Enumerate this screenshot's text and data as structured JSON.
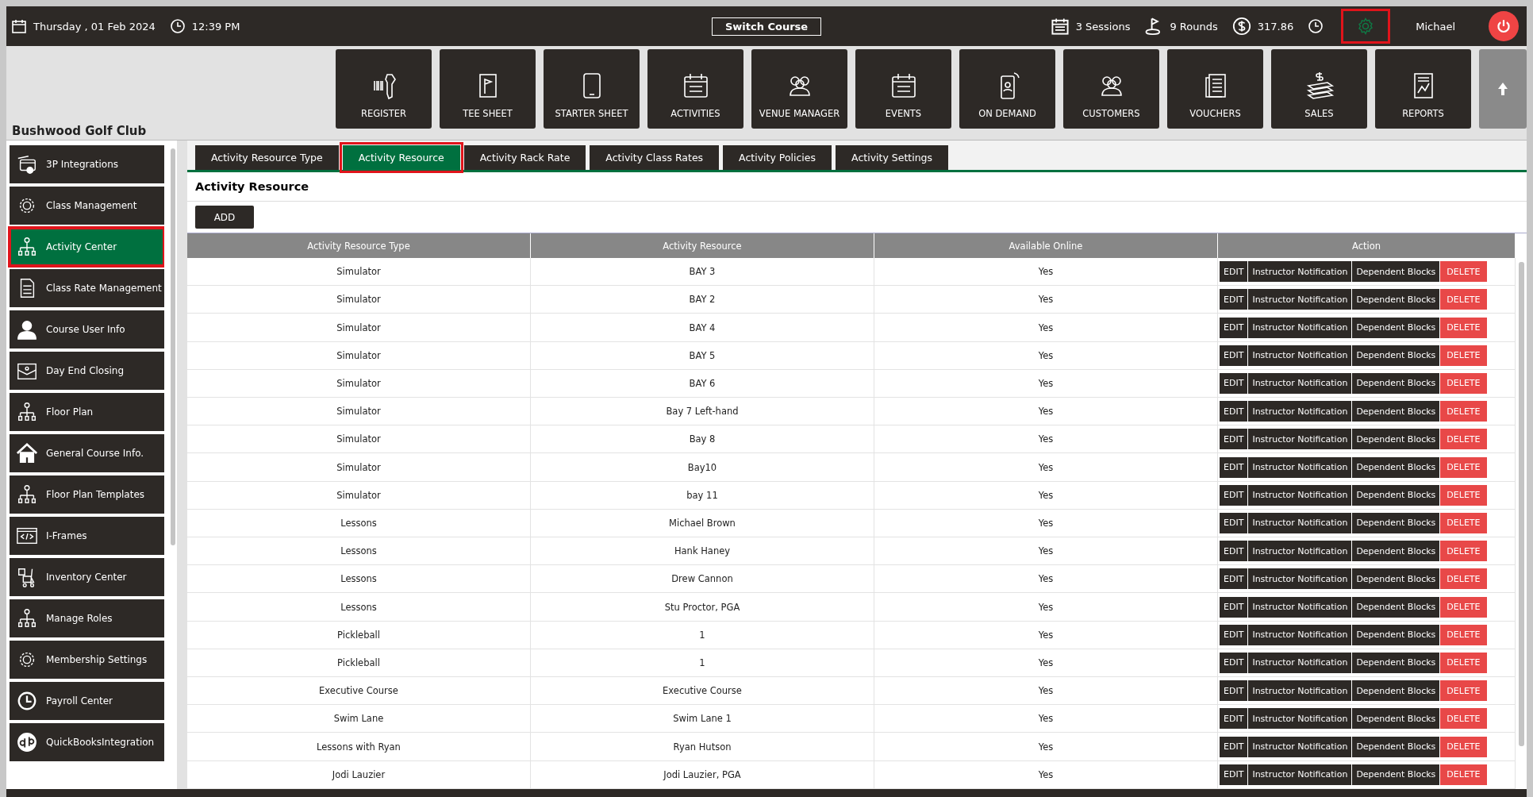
{
  "topbar": {
    "date": "Thursday ,  01 Feb 2024",
    "time": "12:39 PM",
    "switch_course": "Switch Course",
    "sessions": "3 Sessions",
    "rounds": "9 Rounds",
    "balance": "317.86",
    "settings_highlighted": true,
    "user": "Michael"
  },
  "nav_buttons": [
    {
      "label": "REGISTER"
    },
    {
      "label": "TEE SHEET"
    },
    {
      "label": "STARTER SHEET"
    },
    {
      "label": "ACTIVITIES"
    },
    {
      "label": "VENUE MANAGER"
    },
    {
      "label": "EVENTS"
    },
    {
      "label": "ON DEMAND"
    },
    {
      "label": "CUSTOMERS"
    },
    {
      "label": "VOUCHERS"
    },
    {
      "label": "SALES"
    },
    {
      "label": "REPORTS"
    }
  ],
  "club_name": "Bushwood Golf Club",
  "sidebar": {
    "items": [
      {
        "label": "3P Integrations",
        "selected": false
      },
      {
        "label": "Class Management",
        "selected": false
      },
      {
        "label": "Activity  Center",
        "selected": true
      },
      {
        "label": "Class Rate Management",
        "selected": false
      },
      {
        "label": "Course User Info",
        "selected": false
      },
      {
        "label": "Day End Closing",
        "selected": false
      },
      {
        "label": "Floor Plan",
        "selected": false
      },
      {
        "label": "General Course Info.",
        "selected": false
      },
      {
        "label": "Floor Plan Templates",
        "selected": false
      },
      {
        "label": "I-Frames",
        "selected": false
      },
      {
        "label": "Inventory Center",
        "selected": false
      },
      {
        "label": "Manage Roles",
        "selected": false
      },
      {
        "label": "Membership Settings",
        "selected": false
      },
      {
        "label": "Payroll Center",
        "selected": false
      },
      {
        "label": "QuickBooksIntegration",
        "selected": false
      }
    ]
  },
  "tabs": [
    {
      "label": "Activity Resource Type",
      "selected": false
    },
    {
      "label": "Activity Resource",
      "selected": true
    },
    {
      "label": "Activity Rack Rate",
      "selected": false
    },
    {
      "label": "Activity Class Rates",
      "selected": false
    },
    {
      "label": "Activity Policies",
      "selected": false
    },
    {
      "label": "Activity Settings",
      "selected": false
    }
  ],
  "section_title": "Activity Resource",
  "add_button": "ADD",
  "table": {
    "columns": [
      "Activity Resource Type",
      "Activity Resource",
      "Available Online",
      "Action"
    ],
    "rows": [
      {
        "cells": [
          "Simulator",
          "BAY 3",
          "Yes"
        ],
        "actions": [
          "EDIT",
          "Instructor Notification",
          "Dependent Blocks",
          "DELETE"
        ]
      },
      {
        "cells": [
          "Simulator",
          "BAY 2",
          "Yes"
        ],
        "actions": [
          "EDIT",
          "Instructor Notification",
          "Dependent Blocks",
          "DELETE"
        ]
      },
      {
        "cells": [
          "Simulator",
          "BAY 4",
          "Yes"
        ],
        "actions": [
          "EDIT",
          "Instructor Notification",
          "Dependent Blocks",
          "DELETE"
        ]
      },
      {
        "cells": [
          "Simulator",
          "BAY 5",
          "Yes"
        ],
        "actions": [
          "EDIT",
          "Instructor Notification",
          "Dependent Blocks",
          "DELETE"
        ]
      },
      {
        "cells": [
          "Simulator",
          "BAY 6",
          "Yes"
        ],
        "actions": [
          "EDIT",
          "Instructor Notification",
          "Dependent Blocks",
          "DELETE"
        ]
      },
      {
        "cells": [
          "Simulator",
          "Bay 7 Left-hand",
          "Yes"
        ],
        "actions": [
          "EDIT",
          "Instructor Notification",
          "Dependent Blocks",
          "DELETE"
        ]
      },
      {
        "cells": [
          "Simulator",
          "Bay 8",
          "Yes"
        ],
        "actions": [
          "EDIT",
          "Instructor Notification",
          "Dependent Blocks",
          "DELETE"
        ]
      },
      {
        "cells": [
          "Simulator",
          "Bay10",
          "Yes"
        ],
        "actions": [
          "EDIT",
          "Instructor Notification",
          "Dependent Blocks",
          "DELETE"
        ]
      },
      {
        "cells": [
          "Simulator",
          "bay 11",
          "Yes"
        ],
        "actions": [
          "EDIT",
          "Instructor Notification",
          "Dependent Blocks",
          "DELETE"
        ]
      },
      {
        "cells": [
          "Lessons",
          "Michael Brown",
          "Yes"
        ],
        "actions": [
          "EDIT",
          "Instructor Notification",
          "Dependent Blocks",
          "DELETE"
        ]
      },
      {
        "cells": [
          "Lessons",
          "Hank Haney",
          "Yes"
        ],
        "actions": [
          "EDIT",
          "Instructor Notification",
          "Dependent Blocks",
          "DELETE"
        ]
      },
      {
        "cells": [
          "Lessons",
          "Drew Cannon",
          "Yes"
        ],
        "actions": [
          "EDIT",
          "Instructor Notification",
          "Dependent Blocks",
          "DELETE"
        ]
      },
      {
        "cells": [
          "Lessons",
          "Stu Proctor, PGA",
          "Yes"
        ],
        "actions": [
          "EDIT",
          "Instructor Notification",
          "Dependent Blocks",
          "DELETE"
        ]
      },
      {
        "cells": [
          "Pickleball",
          "1",
          "Yes"
        ],
        "actions": [
          "EDIT",
          "Instructor Notification",
          "Dependent Blocks",
          "DELETE"
        ]
      },
      {
        "cells": [
          "Pickleball",
          "1",
          "Yes"
        ],
        "actions": [
          "EDIT",
          "Instructor Notification",
          "Dependent Blocks",
          "DELETE"
        ]
      },
      {
        "cells": [
          "Executive Course",
          "Executive Course",
          "Yes"
        ],
        "actions": [
          "EDIT",
          "Instructor Notification",
          "Dependent Blocks",
          "DELETE"
        ]
      },
      {
        "cells": [
          "Swim Lane",
          "Swim Lane 1",
          "Yes"
        ],
        "actions": [
          "EDIT",
          "Instructor Notification",
          "Dependent Blocks",
          "DELETE"
        ]
      },
      {
        "cells": [
          "Lessons with Ryan",
          "Ryan Hutson",
          "Yes"
        ],
        "actions": [
          "EDIT",
          "Instructor Notification",
          "Dependent Blocks",
          "DELETE"
        ]
      },
      {
        "cells": [
          "Jodi Lauzier",
          "Jodi Lauzier, PGA",
          "Yes"
        ],
        "actions": [
          "EDIT",
          "Instructor Notification",
          "Dependent Blocks",
          "DELETE"
        ]
      }
    ]
  }
}
